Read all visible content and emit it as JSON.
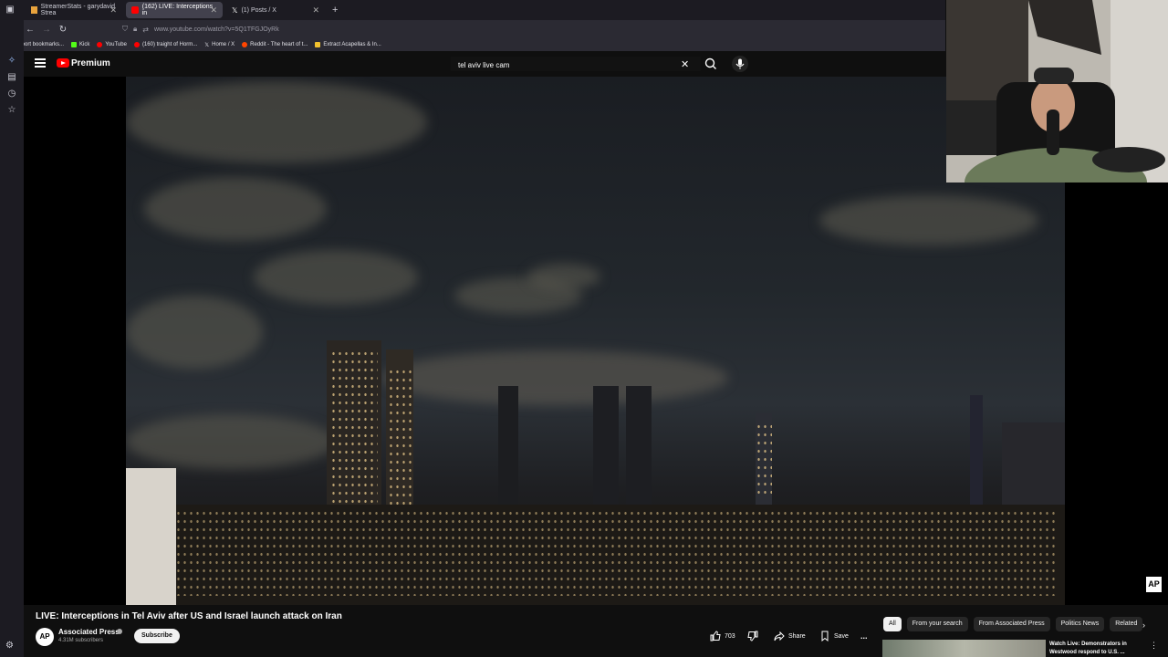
{
  "browser": {
    "tabs": [
      {
        "label": "StreamerStats - garydavid Strea",
        "favicon_color": "#e8a33d",
        "active": false
      },
      {
        "label": "(162) LIVE: Interceptions in",
        "favicon_color": "#ff0000",
        "active": true
      },
      {
        "label": "(1) Posts / X",
        "favicon_color": "#ffffff",
        "active": false
      }
    ],
    "new_tab": "+",
    "url": "www.youtube.com/watch?v=5Q1TFGJOyRk",
    "bookmarks": [
      {
        "label": "Import bookmarks...",
        "color": "#9a99a4"
      },
      {
        "label": "Kick",
        "color": "#53fc18"
      },
      {
        "label": "YouTube",
        "color": "#ff0000"
      },
      {
        "label": "(160) traight of Horm...",
        "color": "#ff0000"
      },
      {
        "label": "Home / X",
        "color": "#ffffff"
      },
      {
        "label": "Reddit - The heart of t...",
        "color": "#ff4500"
      },
      {
        "label": "Extract Acapellas & In...",
        "color": "#f2c12e"
      }
    ]
  },
  "youtube": {
    "logo_text": "Premium",
    "search": {
      "value": "tel aviv live cam",
      "placeholder": "Search"
    },
    "video": {
      "title": "LIVE: Interceptions in Tel Aviv after US and Israel launch attack on Iran",
      "watermark": "AP"
    },
    "channel": {
      "avatar_text": "AP",
      "name": "Associated Press",
      "subscribers": "4.31M subscribers",
      "subscribe_label": "Subscribe"
    },
    "actions": {
      "likes": "703",
      "share_label": "Share",
      "save_label": "Save",
      "more_label": "..."
    },
    "chips": [
      {
        "label": "All",
        "active": true
      },
      {
        "label": "From your search",
        "active": false
      },
      {
        "label": "From Associated Press",
        "active": false
      },
      {
        "label": "Politics News",
        "active": false
      },
      {
        "label": "Related",
        "active": false
      }
    ],
    "recommended": [
      {
        "title": "Watch Live: Demonstrators in Westwood respond to U.S. ..."
      }
    ]
  },
  "colors": {
    "brand": "#ff0000",
    "background": "#0f0f0f",
    "browser_chrome": "#1c1b22"
  }
}
